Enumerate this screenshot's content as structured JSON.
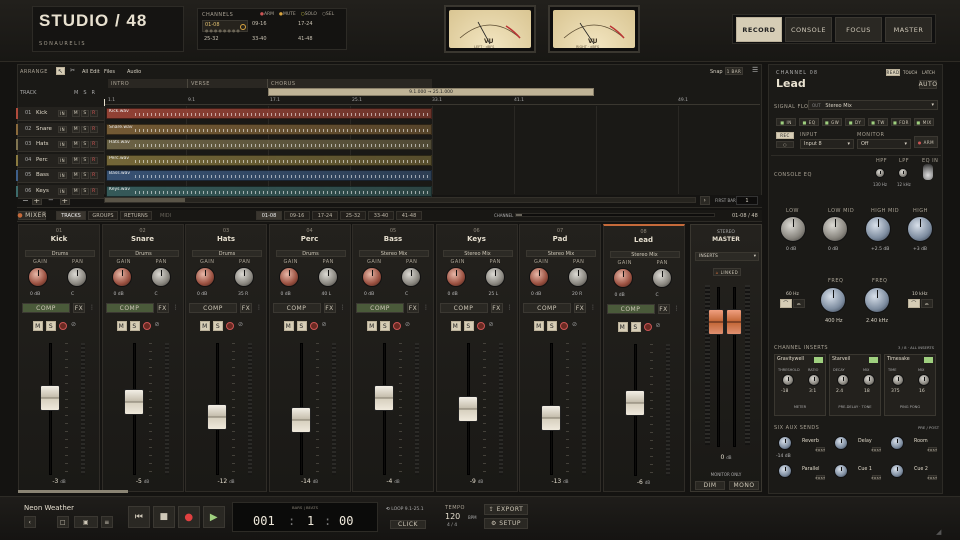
{
  "app": {
    "logo": "STUDIO / 48",
    "brand": "SONAURELIS"
  },
  "channels_panel": {
    "title": "CHANNELS",
    "legend": [
      "ARM",
      "MUTE",
      "SOLO",
      "SEL"
    ],
    "banks": [
      "01-08",
      "09-16",
      "17-24",
      "25-32",
      "33-40",
      "41-48"
    ]
  },
  "vu": {
    "left": "VU",
    "right": "VU",
    "left_cap": "LEFT · dBFS",
    "right_cap": "RIGHT · dBFS"
  },
  "modes": [
    "RECORD",
    "CONSOLE",
    "FOCUS",
    "MASTER"
  ],
  "arrange": {
    "label": "ARRANGE",
    "all": "All",
    "edit": "Edit",
    "files": "Files",
    "audio": "Audio",
    "snap": "Snap",
    "bar": "1 BAR",
    "markers": [
      "INTRO",
      "VERSE",
      "CHORUS"
    ],
    "loop_region": "9.1.000 → 25.1.000",
    "ruler": [
      "1.1",
      "9.1",
      "17.1",
      "25.1",
      "33.1",
      "41.1",
      "49.1"
    ],
    "track_header": "TRACK",
    "msr": [
      "M",
      "S",
      "R"
    ],
    "first_bar_label": "FIRST BAR",
    "first_bar": "1"
  },
  "tracks": [
    {
      "num": "01",
      "name": "Kick",
      "clip": "Kick.wav",
      "color": "#b04b3c"
    },
    {
      "num": "02",
      "name": "Snare",
      "clip": "Snare.wav",
      "color": "#8a6a3c"
    },
    {
      "num": "03",
      "name": "Hats",
      "clip": "Hats.wav",
      "color": "#7f7450"
    },
    {
      "num": "04",
      "name": "Perc",
      "clip": "Perc.wav",
      "color": "#8a7a40"
    },
    {
      "num": "05",
      "name": "Bass",
      "clip": "Bass.wav",
      "color": "#3e5f8a"
    },
    {
      "num": "06",
      "name": "Keys",
      "clip": "Keys.wav",
      "color": "#3c6a6a"
    }
  ],
  "mixer_nav": {
    "mixer": "MIXER",
    "tabs": [
      "TRACKS",
      "GROUPS",
      "RETURNS",
      "MIDI"
    ],
    "banks": [
      "01-08",
      "09-16",
      "17-24",
      "25-32",
      "33-40",
      "41-48"
    ],
    "channel": "CHANNEL",
    "range": "01-08 / 48"
  },
  "strips": [
    {
      "num": "01",
      "name": "Kick",
      "route": "Drums",
      "gain": "0 dB",
      "pan": "C",
      "level": "-3",
      "fader": 0.62
    },
    {
      "num": "02",
      "name": "Snare",
      "route": "Drums",
      "gain": "0 dB",
      "pan": "C",
      "level": "-5",
      "fader": 0.58
    },
    {
      "num": "03",
      "name": "Hats",
      "route": "Drums",
      "gain": "0 dB",
      "pan": "35 R",
      "level": "-12",
      "fader": 0.45
    },
    {
      "num": "04",
      "name": "Perc",
      "route": "Drums",
      "gain": "0 dB",
      "pan": "40 L",
      "level": "-14",
      "fader": 0.42
    },
    {
      "num": "05",
      "name": "Bass",
      "route": "Stereo Mix",
      "gain": "0 dB",
      "pan": "C",
      "level": "-4",
      "fader": 0.62
    },
    {
      "num": "06",
      "name": "Keys",
      "route": "Stereo Mix",
      "gain": "0 dB",
      "pan": "25 L",
      "level": "-9",
      "fader": 0.52
    },
    {
      "num": "07",
      "name": "Pad",
      "route": "Stereo Mix",
      "gain": "0 dB",
      "pan": "20 R",
      "level": "-13",
      "fader": 0.44
    },
    {
      "num": "08",
      "name": "Lead",
      "route": "Stereo Mix",
      "gain": "0 dB",
      "pan": "C",
      "level": "-6",
      "fader": 0.58
    }
  ],
  "strip_labels": {
    "gain": "GAIN",
    "pan": "PAN",
    "comp": "COMP",
    "fx": "FX",
    "m": "M",
    "s": "S",
    "db": "dB"
  },
  "master": {
    "title": "STEREO",
    "name": "MASTER",
    "inserts": "INSERTS",
    "linked": "LINKED",
    "level": "0",
    "db": "dB",
    "monitor": "MONITOR ONLY",
    "dim": "DIM",
    "mono": "MONO"
  },
  "inspector": {
    "channel": "CHANNEL 08",
    "name": "Lead",
    "auto_modes": [
      "READ",
      "TOUCH",
      "LATCH"
    ],
    "auto": "AUTO",
    "signal_flow": "SIGNAL FLOW",
    "out": "OUT",
    "out_val": "Stereo Mix",
    "chain": [
      "IN",
      "EQ",
      "GW",
      "DY",
      "TW",
      "FDR",
      "MIX"
    ],
    "input": "INPUT",
    "input_val": "Input 8",
    "monitor": "MONITOR",
    "monitor_val": "Off",
    "arm": "ARM",
    "eq_title": "CONSOLE EQ",
    "hpf": "HPF",
    "lpf": "LPF",
    "eq_in": "EQ IN",
    "hpf_val": "130 Hz",
    "lpf_val": "12 kHz",
    "bands": [
      "LOW",
      "LOW MID",
      "HIGH MID",
      "HIGH"
    ],
    "band_gain": [
      "0 dB",
      "0 dB",
      "+2.5 dB",
      "+3 dB"
    ],
    "freq": "FREQ",
    "freq_vals": [
      "400 Hz",
      "2.40 kHz"
    ],
    "shelf": [
      "60 Hz",
      "10 kHz"
    ],
    "inserts_title": "CHANNEL INSERTS",
    "inserts_count": "3 / 8 · ALL INSERTS",
    "plugins": [
      {
        "name": "Gravitywell",
        "p1": "THRESHOLD",
        "p2": "RATIO",
        "v1": "-18",
        "v2": "3:1",
        "foot": "METER"
      },
      {
        "name": "Starveil",
        "p1": "DECAY",
        "p2": "MIX",
        "v1": "2.4",
        "v2": "18",
        "foot": "PRE-DELAY · TONE"
      },
      {
        "name": "Timesake",
        "p1": "TIME",
        "p2": "MIX",
        "v1": "375",
        "v2": "16",
        "foot": "PING PONG"
      }
    ],
    "sends_title": "SIX AUX SENDS",
    "sends_right": "PRE / POST",
    "sends": [
      {
        "name": "Reverb",
        "val": "-14 dB"
      },
      {
        "name": "Delay",
        "val": ""
      },
      {
        "name": "Room",
        "val": ""
      },
      {
        "name": "Parallel",
        "val": ""
      },
      {
        "name": "Cue 1",
        "val": ""
      },
      {
        "name": "Cue 2",
        "val": ""
      }
    ],
    "post": "POST"
  },
  "transport": {
    "song": "Neon Weather",
    "time_label": "BARS | BEATS",
    "bars": "001",
    "beats": "1",
    "ticks": "00",
    "loop": "LOOP 9.1-25.1",
    "click": "CLICK",
    "tempo_label": "TEMPO",
    "tempo": "120",
    "bpm": "BPM",
    "sig": "4 / 4",
    "export": "EXPORT",
    "setup": "SETUP"
  },
  "colors": {
    "accent": "#d6cdb6",
    "orange": "#c56a3a",
    "green": "#6b8f52"
  }
}
